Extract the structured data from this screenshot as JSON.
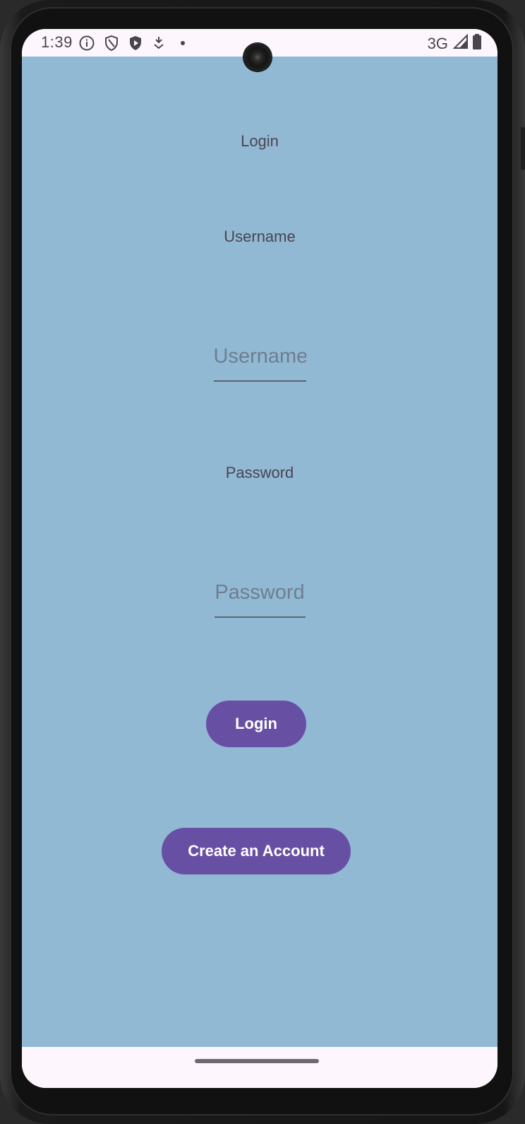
{
  "status_bar": {
    "time": "1:39",
    "network": "3G",
    "icons": [
      "info-icon",
      "shield-icon",
      "play-protect-icon",
      "download-icon",
      "dot-icon",
      "signal-icon",
      "battery-icon"
    ]
  },
  "login_screen": {
    "title": "Login",
    "username_label": "Username",
    "username_placeholder": "Username",
    "username_value": "",
    "password_label": "Password",
    "password_placeholder": "Password",
    "password_value": "",
    "login_button": "Login",
    "create_account_button": "Create an Account"
  },
  "colors": {
    "background": "#92b9d4",
    "button": "#6750a4",
    "button_text": "#ffffff",
    "label_text": "#49454f",
    "system_bar": "#fdf7fd"
  }
}
